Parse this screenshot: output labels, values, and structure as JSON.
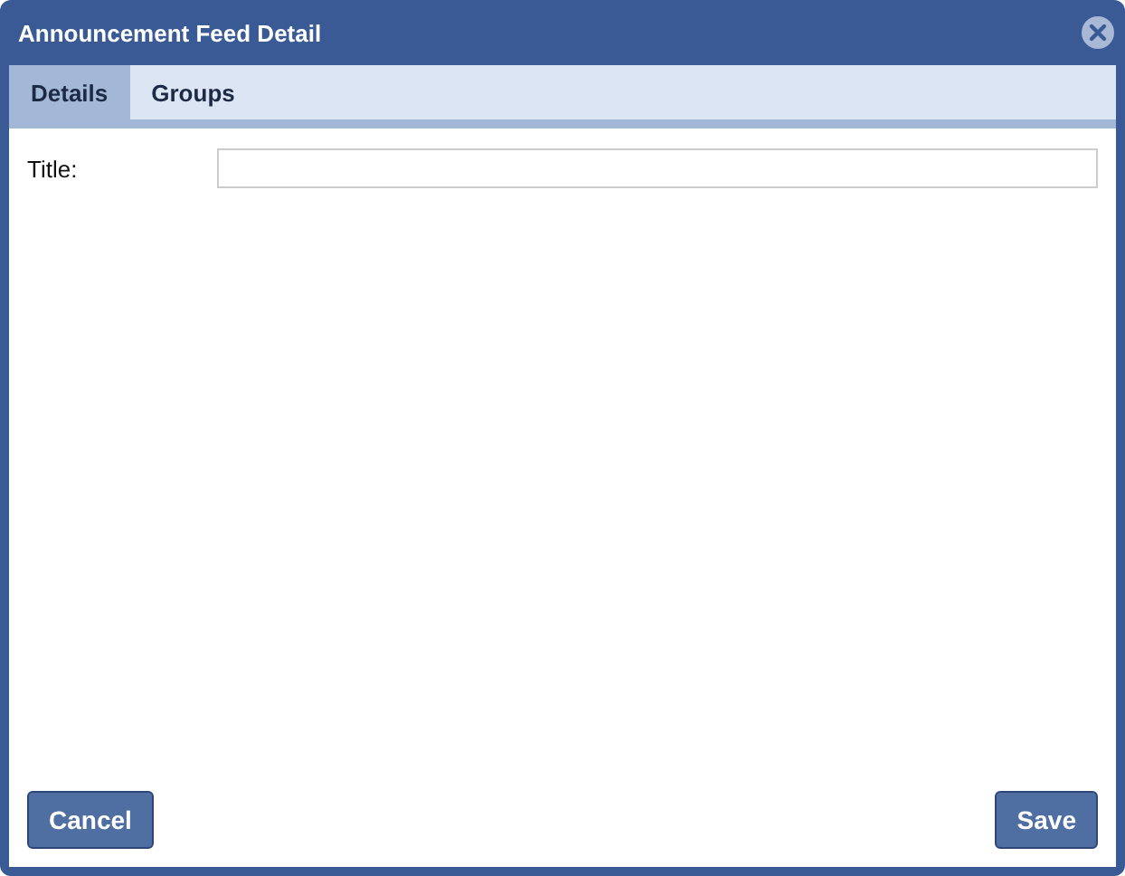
{
  "window": {
    "title": "Announcement Feed Detail"
  },
  "tabs": [
    {
      "label": "Details",
      "selected": true
    },
    {
      "label": "Groups",
      "selected": false
    }
  ],
  "fields": [
    {
      "label": "Title:"
    }
  ],
  "buttons": [
    {
      "label": "Cancel",
      "kind": "left"
    },
    {
      "label": "Save",
      "kind": "right"
    }
  ]
}
